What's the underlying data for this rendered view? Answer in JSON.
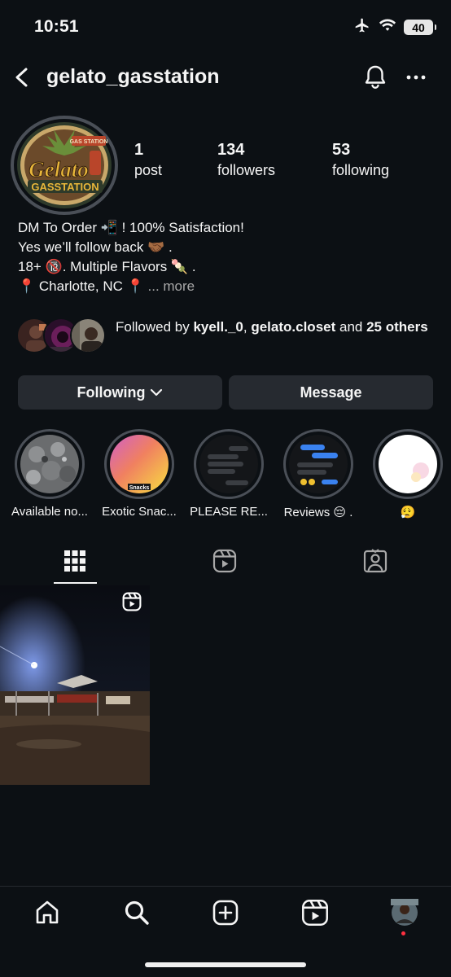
{
  "status_bar": {
    "time": "10:51",
    "battery": "40"
  },
  "header": {
    "username": "gelato_gasstation"
  },
  "avatar": {
    "logo_text_top": "Gelato",
    "logo_text_bottom": "GASSTATION",
    "logo_small": "GAS STATION"
  },
  "stats": [
    {
      "value": "1",
      "label": "post"
    },
    {
      "value": "134",
      "label": "followers"
    },
    {
      "value": "53",
      "label": "following"
    }
  ],
  "bio": {
    "lines": [
      "DM To Order 📲 ! 100% Satisfaction!",
      "Yes we’ll follow back 🤝🏾 .",
      "18+ 🔞. Multiple Flavors 🍡 .",
      "📍 Charlotte, NC 📍"
    ],
    "more": "... more"
  },
  "followed_by": {
    "prefix": "Followed by ",
    "user1": "kyell._0",
    "sep": ", ",
    "user2": "gelato.closet",
    "and": " and ",
    "others": "25 others"
  },
  "buttons": {
    "following": "Following",
    "message": "Message"
  },
  "highlights": [
    {
      "label": "Available no..."
    },
    {
      "label": "Exotic Snac...",
      "overlay": "Snacks"
    },
    {
      "label": "PLEASE RE..."
    },
    {
      "label": "Reviews 😔 ."
    },
    {
      "label": "😮‍💨"
    }
  ],
  "colors": {
    "background": "#0c1014",
    "button": "#262a30",
    "text": "#f5f5f5",
    "muted": "#a8a8a8",
    "notification_dot": "#ff3040"
  }
}
